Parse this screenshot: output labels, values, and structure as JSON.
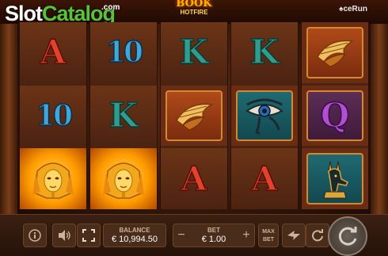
{
  "watermark": {
    "slot": "Slot",
    "catalog": "Catalog",
    "com": ".com"
  },
  "game": {
    "title": "BOOK",
    "subtitle": "HOTFIRE",
    "provider": "ceRun"
  },
  "reels": [
    [
      {
        "type": "letter",
        "text": "A",
        "color": "red"
      },
      {
        "type": "letter",
        "text": "10",
        "color": "blue"
      },
      {
        "type": "symbol",
        "name": "pharaoh-mask"
      }
    ],
    [
      {
        "type": "letter",
        "text": "10",
        "color": "blue"
      },
      {
        "type": "letter",
        "text": "K",
        "color": "teal"
      },
      {
        "type": "symbol",
        "name": "pharaoh-mask"
      }
    ],
    [
      {
        "type": "letter",
        "text": "K",
        "color": "teal"
      },
      {
        "type": "symbol",
        "name": "wing-scarab"
      },
      {
        "type": "letter",
        "text": "A",
        "color": "red"
      }
    ],
    [
      {
        "type": "letter",
        "text": "K",
        "color": "teal"
      },
      {
        "type": "symbol",
        "name": "eye-of-horus"
      },
      {
        "type": "letter",
        "text": "A",
        "color": "red"
      }
    ],
    [
      {
        "type": "symbol",
        "name": "wing-scarab"
      },
      {
        "type": "letter",
        "text": "Q",
        "color": "purple"
      },
      {
        "type": "symbol",
        "name": "anubis"
      }
    ]
  ],
  "controls": {
    "balance_label": "BALANCE",
    "balance_value": "€ 10,994.50",
    "bet_label": "BET",
    "bet_value": "€ 1.00",
    "minus": "−",
    "plus": "+",
    "max_bet_line1": "MAX",
    "max_bet_line2": "BET",
    "icons": [
      "info-icon",
      "sound-icon",
      "fullscreen-icon",
      "turbo-icon",
      "autoplay-icon",
      "spin-icon"
    ]
  },
  "colors": {
    "gold": "#ffb400",
    "brand_green": "#58c23a"
  }
}
